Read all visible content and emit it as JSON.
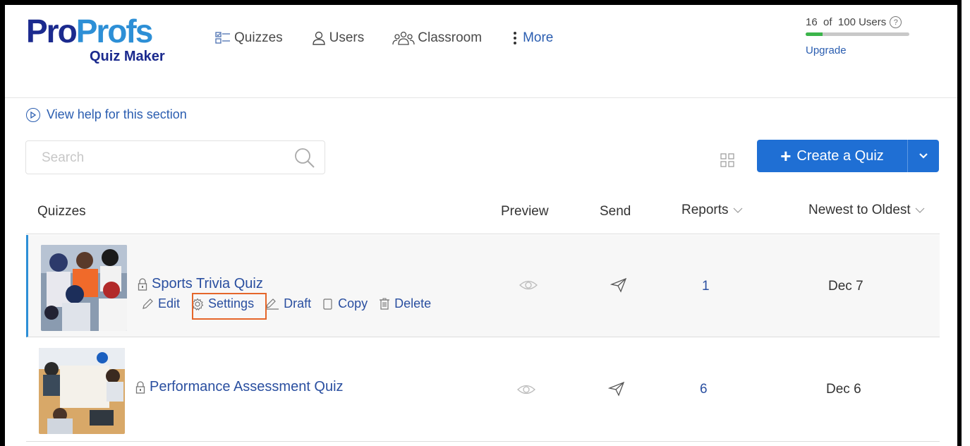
{
  "logo": {
    "pro": "Pro",
    "profs": "Profs",
    "sub": "Quiz Maker"
  },
  "nav": [
    {
      "label": "Quizzes",
      "icon": "quizzes-icon"
    },
    {
      "label": "Users",
      "icon": "user-icon"
    },
    {
      "label": "Classroom",
      "icon": "classroom-icon"
    },
    {
      "label": "More",
      "icon": "more-dots-icon"
    }
  ],
  "users": {
    "count": "16",
    "of": "of",
    "total": "100",
    "label": "Users",
    "upgrade": "Upgrade",
    "progress_fraction": 0.16
  },
  "help": {
    "label": "View help for this section"
  },
  "search": {
    "placeholder": "Search",
    "value": ""
  },
  "create": {
    "label": "Create a Quiz"
  },
  "table": {
    "headers": {
      "quizzes": "Quizzes",
      "preview": "Preview",
      "send": "Send",
      "reports": "Reports",
      "sort": "Newest to Oldest"
    },
    "rows": [
      {
        "title": "Sports Trivia Quiz",
        "reports": "1",
        "date": "Dec 7",
        "actions": {
          "edit": "Edit",
          "settings": "Settings",
          "draft": "Draft",
          "copy": "Copy",
          "delete": "Delete"
        }
      },
      {
        "title": "Performance Assessment Quiz",
        "reports": "6",
        "date": "Dec 6"
      }
    ]
  },
  "colors": {
    "accent": "#1f6fd4",
    "highlight": "#e5662a",
    "link": "#2a4fa0",
    "progress": "#3bb54a"
  }
}
